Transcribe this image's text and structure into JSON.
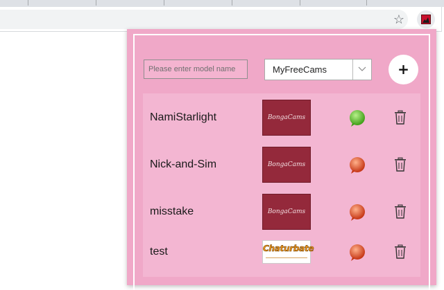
{
  "browser": {
    "bookmark_icon": "star-icon",
    "extension_icon": "extension-icon"
  },
  "popup": {
    "search": {
      "placeholder": "Please enter model name",
      "value": ""
    },
    "site_select": {
      "selected": "MyFreeCams",
      "arrow_icon": "chevron-down-icon"
    },
    "add_button": {
      "label": "+"
    },
    "models": [
      {
        "name": "NamiStarlight",
        "site": "BongaCams",
        "site_logo_text": "BongaCams",
        "online": true,
        "status_color": "#5cc02a"
      },
      {
        "name": "Nick-and-Sim",
        "site": "BongaCams",
        "site_logo_text": "BongaCams",
        "online": false,
        "status_color": "#e0482a"
      },
      {
        "name": "misstake",
        "site": "BongaCams",
        "site_logo_text": "BongaCams",
        "online": false,
        "status_color": "#e0482a"
      },
      {
        "name": "test",
        "site": "Chaturbate",
        "site_logo_text": "Chaturbate",
        "online": false,
        "status_color": "#e0482a"
      }
    ],
    "colors": {
      "popup_bg": "#f0a8c8",
      "list_bg": "#f3b6d2",
      "online": "#5cc02a",
      "offline": "#e0482a"
    }
  }
}
